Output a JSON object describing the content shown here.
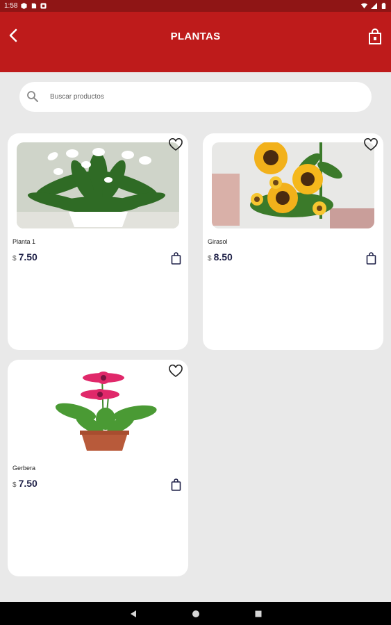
{
  "status_bar": {
    "time": "1:58"
  },
  "app_bar": {
    "title": "PLANTAS"
  },
  "search": {
    "placeholder": "Buscar productos",
    "value": ""
  },
  "products": [
    {
      "name": "Planta 1",
      "currency": "$",
      "price": "7.50",
      "image": "peace-lily-plant"
    },
    {
      "name": "Girasol",
      "currency": "$",
      "price": "8.50",
      "image": "sunflower-arrangement"
    },
    {
      "name": "Gerbera",
      "currency": "$",
      "price": "7.50",
      "image": "pink-gerbera-pot"
    }
  ],
  "colors": {
    "app_bar": "#be1b1b",
    "status_bar": "#8f1515",
    "price": "#1f2148",
    "background": "#e9e9e9"
  }
}
